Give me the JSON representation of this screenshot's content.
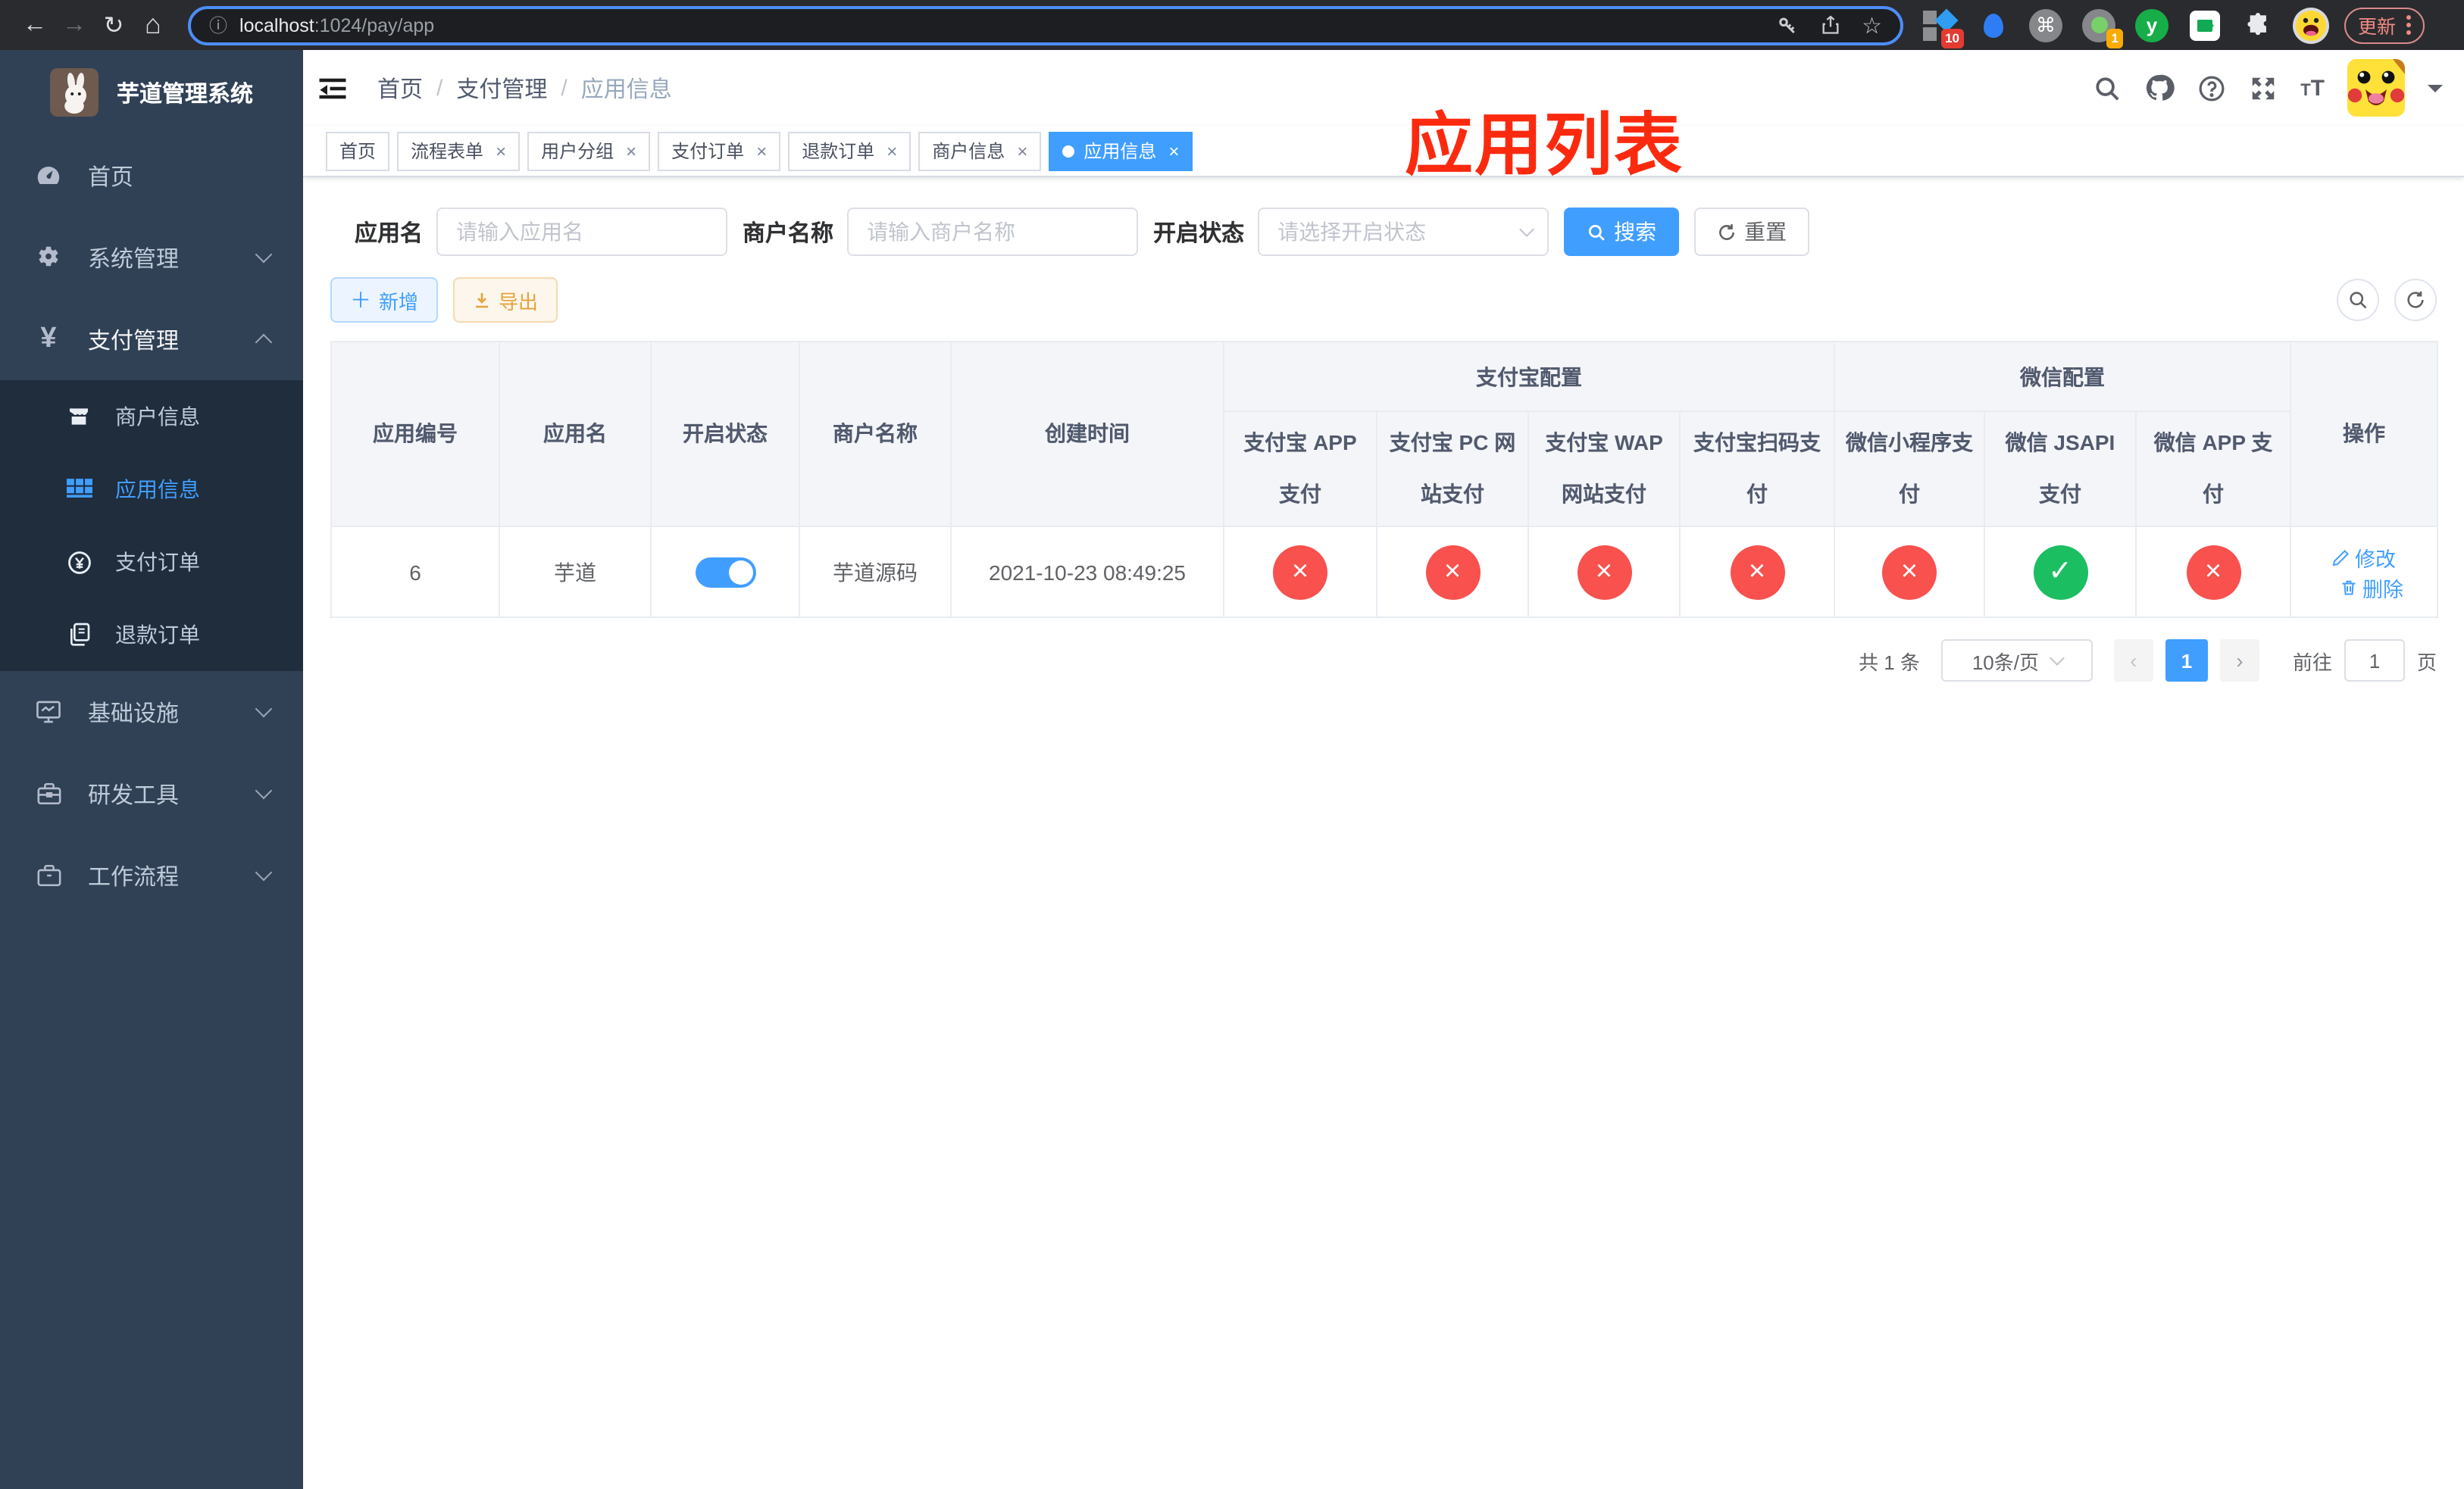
{
  "browser": {
    "url_primary": "localhost",
    "url_secondary": ":1024/pay/app",
    "ext_badge_a": "10",
    "ext_badge_b": "1",
    "update_label": "更新"
  },
  "sidebar": {
    "title": "芋道管理系统",
    "menu": [
      {
        "label": "首页",
        "icon": "dashboard-icon"
      },
      {
        "label": "系统管理",
        "icon": "gear-icon"
      },
      {
        "label": "支付管理",
        "icon": "yen-icon"
      }
    ],
    "submenu": [
      {
        "label": "商户信息",
        "icon": "store-icon"
      },
      {
        "label": "应用信息",
        "icon": "grid-icon",
        "active": true
      },
      {
        "label": "支付订单",
        "icon": "yen-circle-icon"
      },
      {
        "label": "退款订单",
        "icon": "document-icon"
      }
    ],
    "menu2": [
      {
        "label": "基础设施",
        "icon": "monitor-icon"
      },
      {
        "label": "研发工具",
        "icon": "toolbox-icon"
      },
      {
        "label": "工作流程",
        "icon": "briefcase-icon"
      }
    ]
  },
  "navbar": {
    "breadcrumb": [
      "首页",
      "支付管理",
      "应用信息"
    ],
    "annotation": "应用列表"
  },
  "tabs": [
    {
      "label": "首页"
    },
    {
      "label": "流程表单"
    },
    {
      "label": "用户分组"
    },
    {
      "label": "支付订单"
    },
    {
      "label": "退款订单"
    },
    {
      "label": "商户信息"
    },
    {
      "label": "应用信息"
    }
  ],
  "filters": {
    "app_name_label": "应用名",
    "app_name_placeholder": "请输入应用名",
    "merchant_label": "商户名称",
    "merchant_placeholder": "请输入商户名称",
    "status_label": "开启状态",
    "status_placeholder": "请选择开启状态",
    "search_label": "搜索",
    "reset_label": "重置"
  },
  "toolbar": {
    "add_label": "新增",
    "export_label": "导出"
  },
  "table": {
    "columns": [
      "应用编号",
      "应用名",
      "开启状态",
      "商户名称",
      "创建时间"
    ],
    "group_alipay": "支付宝配置",
    "group_wechat": "微信配置",
    "alipay_columns": [
      "支付宝 APP 支付",
      "支付宝 PC 网站支付",
      "支付宝 WAP 网站支付",
      "支付宝扫码支付"
    ],
    "wechat_columns": [
      "微信小程序支付",
      "微信 JSAPI 支付",
      "微信 APP 支付"
    ],
    "actions_column": "操作",
    "row": {
      "id": "6",
      "name": "芋道",
      "enabled": true,
      "merchant": "芋道源码",
      "created_at": "2021-10-23 08:49:25",
      "channels": [
        {
          "name": "alipay-app",
          "enabled": false
        },
        {
          "name": "alipay-pc",
          "enabled": false
        },
        {
          "name": "alipay-wap",
          "enabled": false
        },
        {
          "name": "alipay-qr",
          "enabled": false
        },
        {
          "name": "wechat-lite",
          "enabled": false
        },
        {
          "name": "wechat-jsapi",
          "enabled": true
        },
        {
          "name": "wechat-app",
          "enabled": false
        }
      ],
      "edit_label": "修改",
      "delete_label": "删除"
    }
  },
  "pagination": {
    "total": "共 1 条",
    "page_size": "10条/页",
    "current_page": "1",
    "goto_label": "前往",
    "goto_value": "1",
    "unit_label": "页"
  },
  "colors": {
    "primary": "#409eff",
    "success": "#1cbe62",
    "danger": "#f8514e",
    "warning": "#e6a23c",
    "sidebar_bg": "#304156",
    "submenu_bg": "#1f2d3d",
    "annotation_red": "#fb2a0f"
  }
}
